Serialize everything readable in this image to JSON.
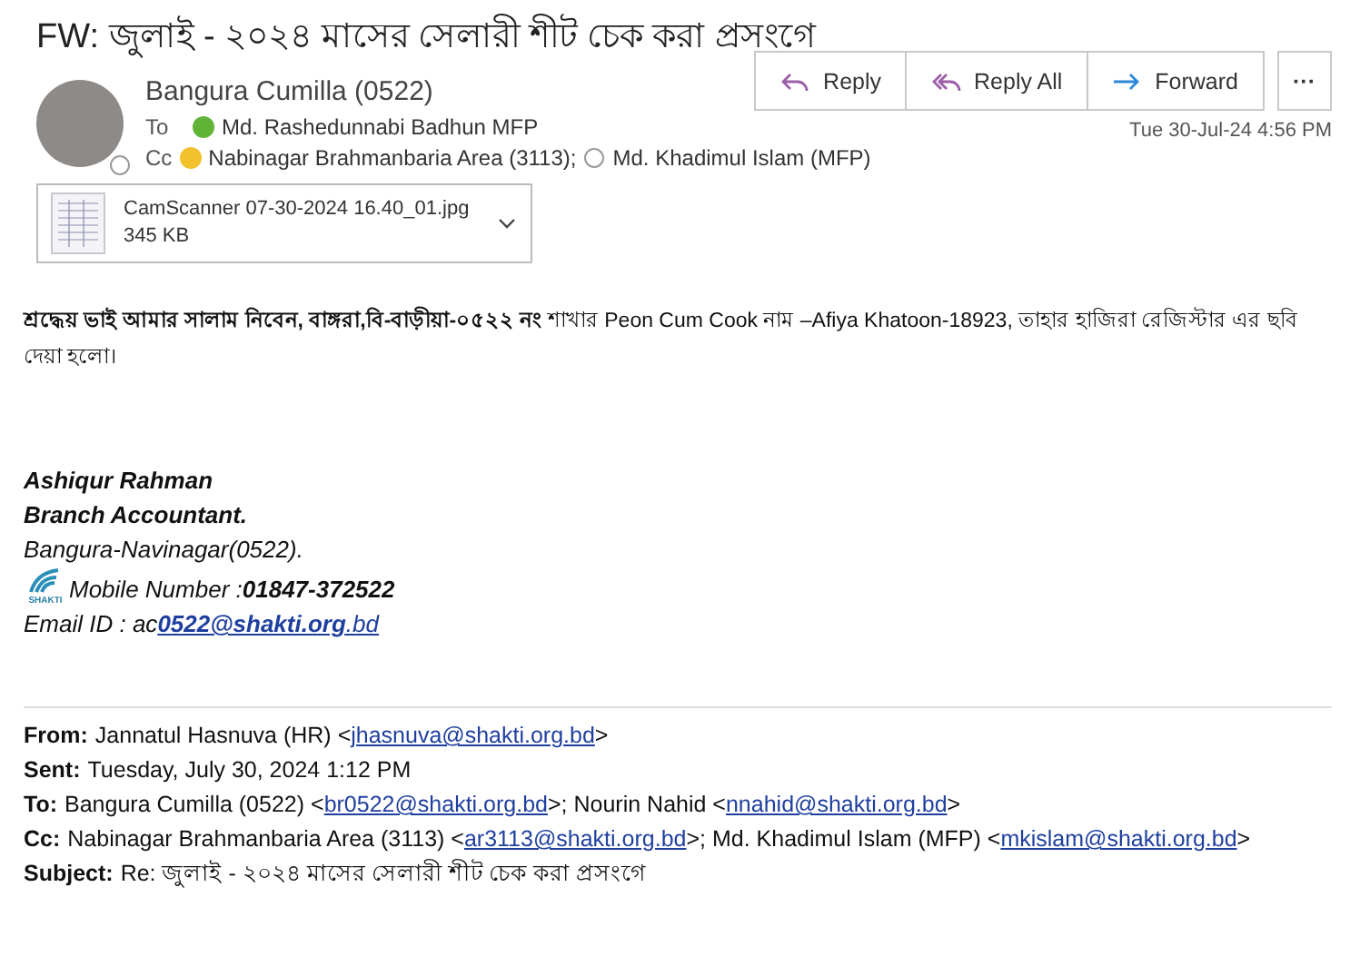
{
  "subject": "FW: জুলাই - ২০২৪ মাসের সেলারী শীট চেক করা প্রসংগে",
  "sender": {
    "name": "Bangura Cumilla (0522)"
  },
  "recipients": [
    {
      "label": "To",
      "people": [
        {
          "name": "Md. Rashedunnabi Badhun MFP",
          "color": "#5fb336"
        }
      ]
    },
    {
      "label": "Cc",
      "people": [
        {
          "name": "Nabinagar Brahmanbaria Area (3113);",
          "color": "#f2c12e"
        },
        {
          "name": "Md. Khadimul Islam (MFP)"
        }
      ]
    }
  ],
  "actions": [
    {
      "kind": "reply",
      "label": "Reply"
    },
    {
      "kind": "reply_all",
      "label": "Reply All"
    },
    {
      "kind": "forward",
      "label": "Forward"
    },
    {
      "kind": "more",
      "label": "···"
    }
  ],
  "date": "Tue 30-Jul-24 4:56 PM",
  "attachment": {
    "name": "CamScanner 07-30-2024 16.40_01.jpg",
    "size": "345 KB"
  },
  "body": "**শ্রদ্ধেয় ভাই আমার  সালাম নিবেন, বাঙ্গরা,বি-বাড়ীয়া-০৫২২ নং** শাখার Peon Cum Cook নাম  –Afiya Khatoon-18923, তাহার হাজিরা রেজিস্টার এর ছবি দেয়া হলো।",
  "signature": {
    "lines": [
      {
        "kind": "bold",
        "text": "Ashiqur Rahman"
      },
      {
        "kind": "bold",
        "text": "Branch Accountant."
      },
      {
        "kind": "plain",
        "text": "Bangura-Navinagar(0522)."
      }
    ],
    "logo_text": "SHAKTI",
    "mobile_label": "Mobile Number : ",
    "mobile": "01847-372522",
    "email_label": "Email ID : ac",
    "email_link": "0522@shakti.org",
    "email_tail": ".bd"
  },
  "forwarded": [
    {
      "label": "From:",
      "parts": [
        {
          "kind": "text",
          "text": "Jannatul Hasnuva (HR) <"
        },
        {
          "kind": "link",
          "text": "jhasnuva@shakti.org.bd"
        },
        {
          "kind": "text",
          "text": ">"
        }
      ]
    },
    {
      "label": "Sent:",
      "parts": [
        {
          "kind": "text",
          "text": "Tuesday, July 30, 2024 1:12 PM"
        }
      ]
    },
    {
      "label": "To:",
      "parts": [
        {
          "kind": "text",
          "text": "Bangura Cumilla (0522) <"
        },
        {
          "kind": "link",
          "text": "br0522@shakti.org.bd"
        },
        {
          "kind": "text",
          "text": ">; Nourin Nahid <"
        },
        {
          "kind": "link",
          "text": "nnahid@shakti.org.bd"
        },
        {
          "kind": "text",
          "text": ">"
        }
      ]
    },
    {
      "label": "Cc:",
      "parts": [
        {
          "kind": "text",
          "text": "Nabinagar Brahmanbaria Area (3113) <"
        },
        {
          "kind": "link",
          "text": "ar3113@shakti.org.bd"
        },
        {
          "kind": "text",
          "text": ">; Md. Khadimul Islam (MFP) <"
        },
        {
          "kind": "link",
          "text": "mkislam@shakti.org.bd"
        },
        {
          "kind": "text",
          "text": ">"
        }
      ]
    },
    {
      "label": "Subject:",
      "parts": [
        {
          "kind": "text",
          "text": "Re: জুলাই - ২০২৪ মাসের সেলারী শীট চেক করা প্রসংগে"
        }
      ]
    }
  ]
}
